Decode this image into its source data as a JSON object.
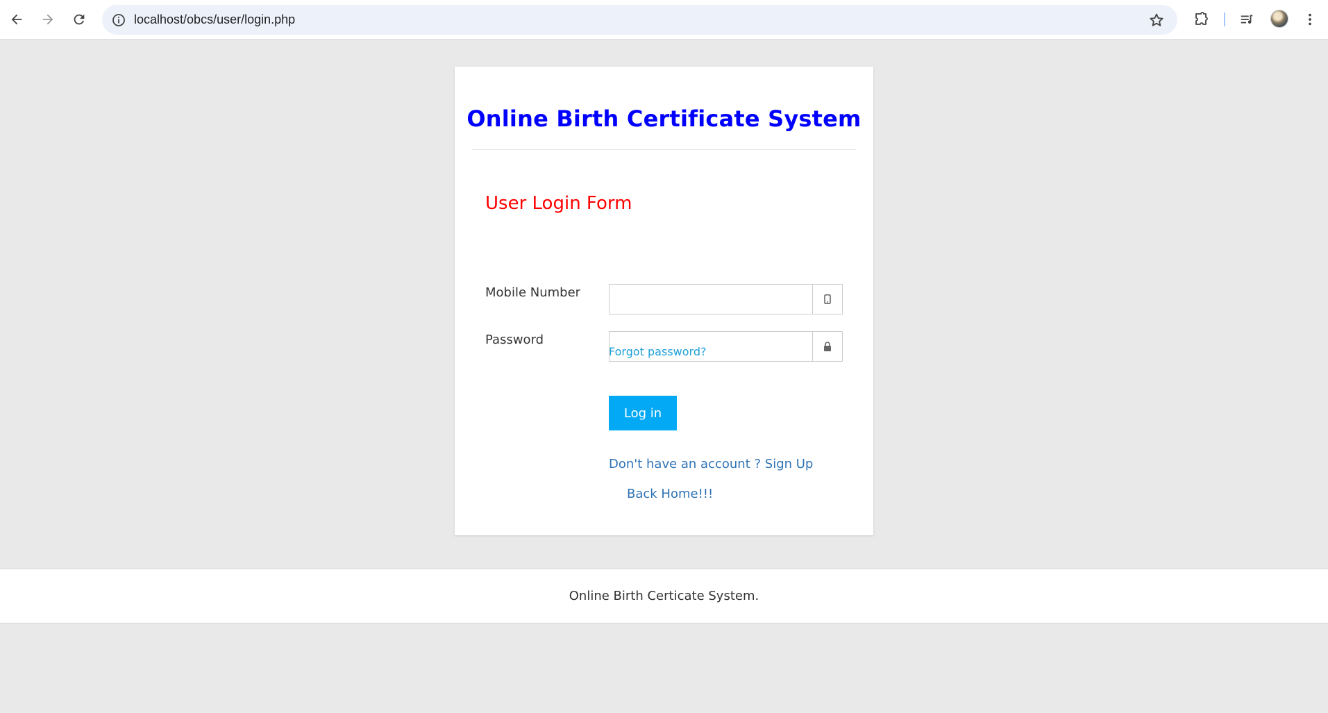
{
  "browser": {
    "url": "localhost/obcs/user/login.php",
    "icons": {
      "back": "back-arrow-icon",
      "forward": "forward-arrow-icon",
      "reload": "reload-icon",
      "site_info": "info-icon",
      "bookmark": "star-icon",
      "extensions": "puzzle-icon",
      "media": "media-queue-icon",
      "profile": "avatar",
      "menu": "kebab-menu-icon"
    }
  },
  "card": {
    "site_title": "Online Birth Certificate System",
    "form_title": "User Login Form",
    "mobile_label": "Mobile Number",
    "mobile_value": "",
    "password_label": "Password",
    "password_value": "",
    "forgot_link": "Forgot password?",
    "login_button": "Log in",
    "signup_link": "Don't have an account ? Sign Up",
    "home_link": "Back Home!!!"
  },
  "footer": {
    "text": "Online Birth Certicate System."
  },
  "colors": {
    "site_title": "#0000ff",
    "form_title": "#ff0000",
    "button": "#03a9f4",
    "link": "#2f73b5",
    "page_bg": "#e9e9e9"
  }
}
